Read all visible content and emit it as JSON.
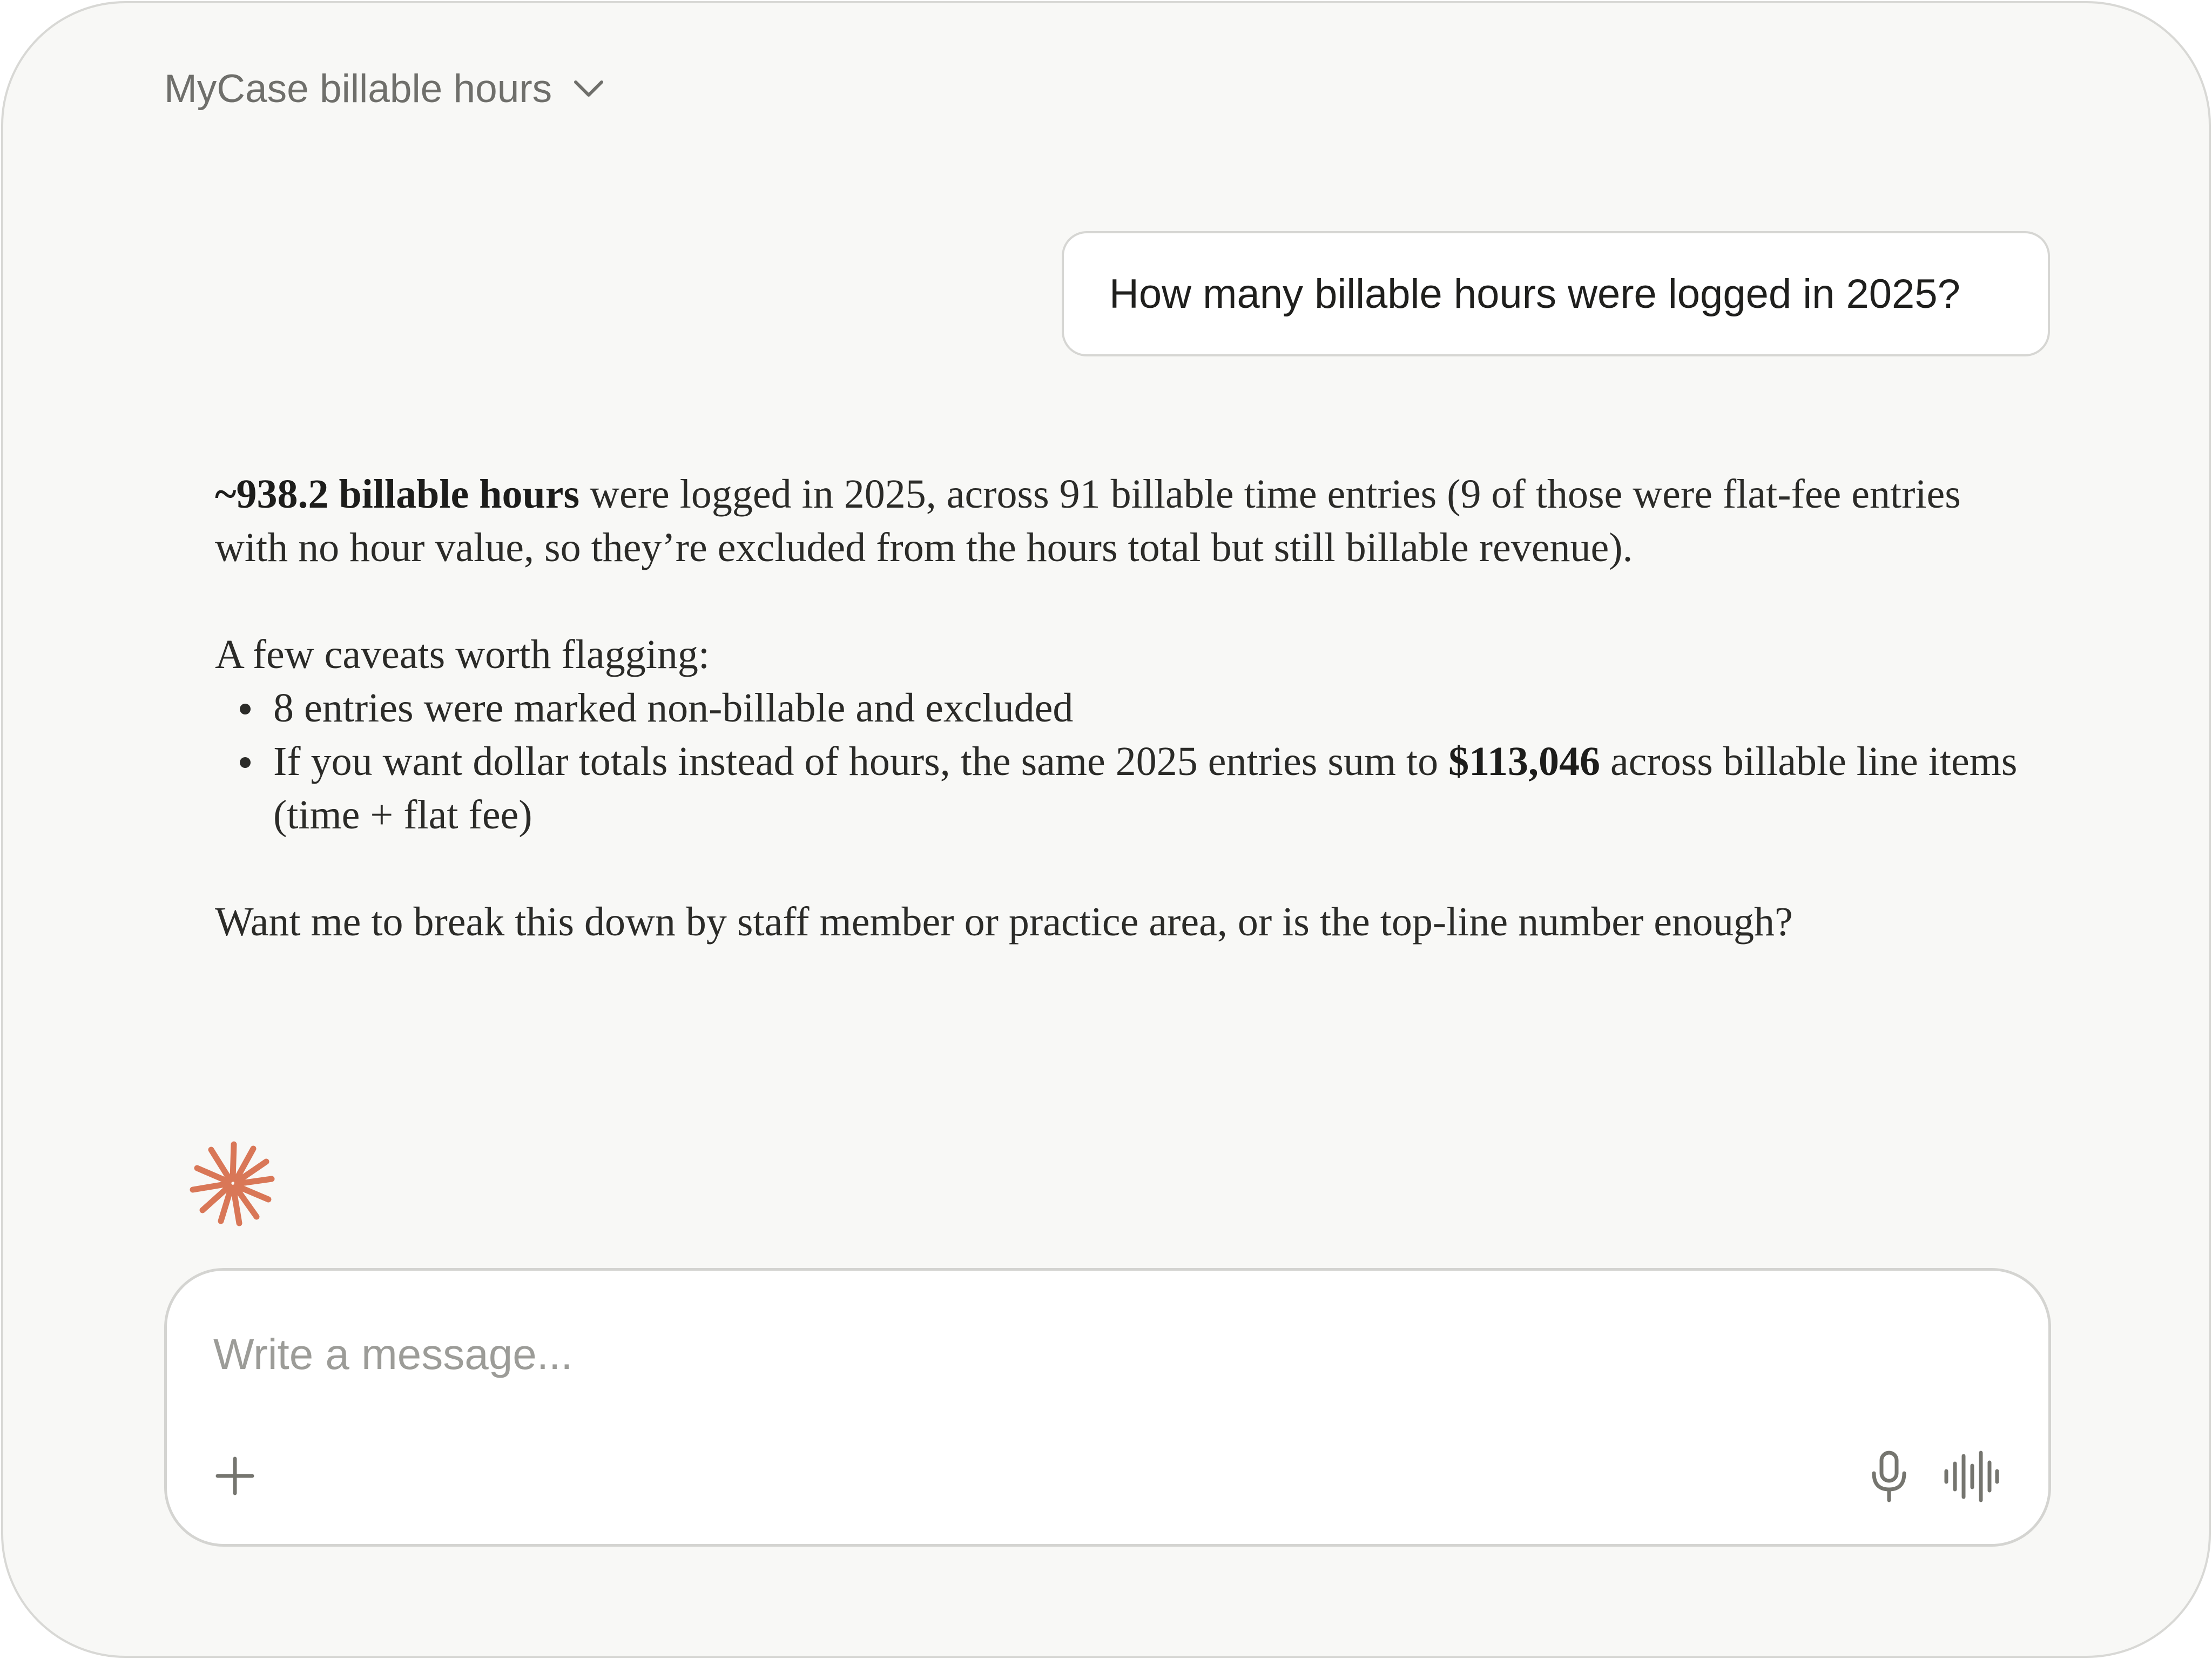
{
  "header": {
    "chat_title": "MyCase billable hours",
    "dropdown_icon": "chevron-down-icon"
  },
  "user_message": {
    "text": "How many billable hours were logged in 2025?"
  },
  "assistant_message": {
    "para1_bold": "~938.2 billable hours",
    "para1_rest": " were logged in 2025, across 91 billable time entries (9 of those were flat-fee entries with no hour value, so they’re excluded from the hours total but still billable revenue).",
    "caveats_intro": "A few caveats worth flagging:",
    "bullet1": "8 entries were marked non-billable and excluded",
    "bullet2_pre": "If you want dollar totals instead of hours, the same 2025 entries sum to ",
    "bullet2_bold": "$113,046",
    "bullet2_post": " across billable line items (time + flat fee)",
    "closing": "Want me to break this down by staff member or practice area, or is the top-line number enough?"
  },
  "logo": {
    "icon": "spark-logo-icon",
    "color": "#d97757"
  },
  "composer": {
    "placeholder": "Write a message...",
    "value": "",
    "add_icon": "plus-icon",
    "mic_icon": "microphone-icon",
    "voice_icon": "voice-waveform-icon"
  }
}
